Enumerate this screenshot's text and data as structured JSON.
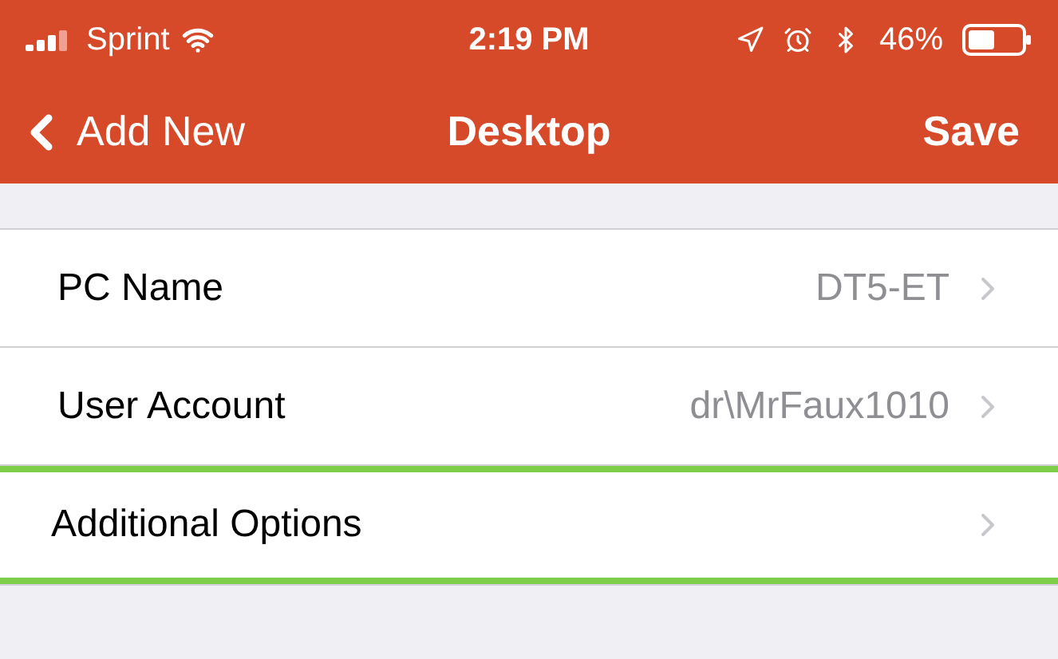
{
  "status_bar": {
    "carrier": "Sprint",
    "time": "2:19 PM",
    "battery": "46%"
  },
  "nav": {
    "back": "Add New",
    "title": "Desktop",
    "action": "Save"
  },
  "rows": [
    {
      "label": "PC Name",
      "value": "DT5-ET",
      "highlighted": false
    },
    {
      "label": "User Account",
      "value": "dr\\MrFaux1010",
      "highlighted": false
    },
    {
      "label": "Additional Options",
      "highlighted": true
    }
  ]
}
